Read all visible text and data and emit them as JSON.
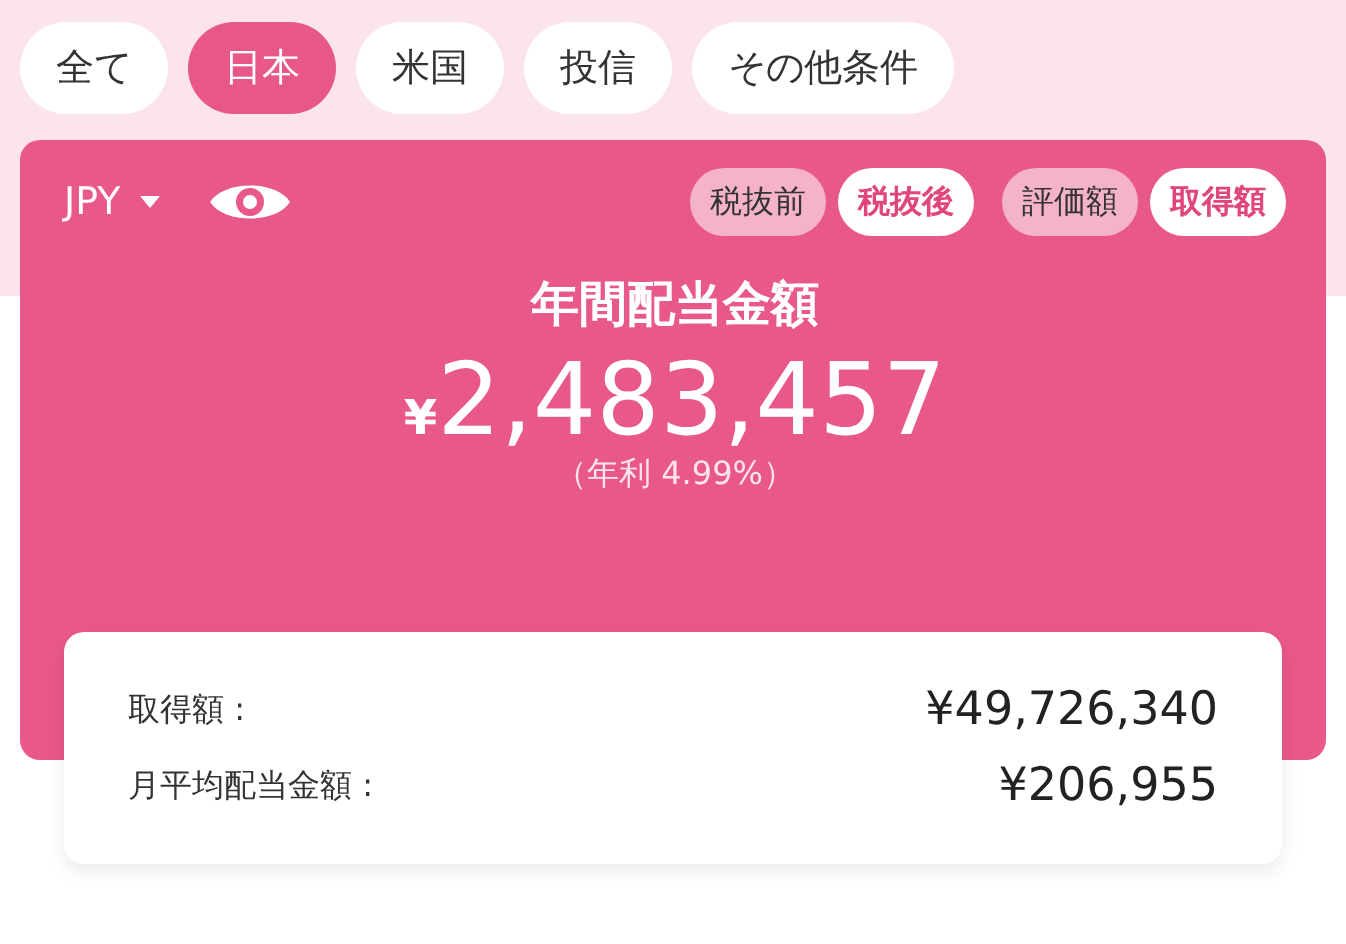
{
  "filters": [
    {
      "label": "全て",
      "selected": false
    },
    {
      "label": "日本",
      "selected": true
    },
    {
      "label": "米国",
      "selected": false
    },
    {
      "label": "投信",
      "selected": false
    },
    {
      "label": "その他条件",
      "selected": false
    }
  ],
  "summary": {
    "currency": "JPY",
    "tax_toggle": [
      {
        "label": "税抜前",
        "selected": false
      },
      {
        "label": "税抜後",
        "selected": true
      }
    ],
    "basis_toggle": [
      {
        "label": "評価額",
        "selected": false
      },
      {
        "label": "取得額",
        "selected": true
      }
    ],
    "title": "年間配当金額",
    "currency_symbol": "¥",
    "amount": "2,483,457",
    "yield": "（年利 4.99%）"
  },
  "details": [
    {
      "label": "取得額 :",
      "value": "¥49,726,340"
    },
    {
      "label": "月平均配当金額 :",
      "value": "¥206,955"
    }
  ]
}
